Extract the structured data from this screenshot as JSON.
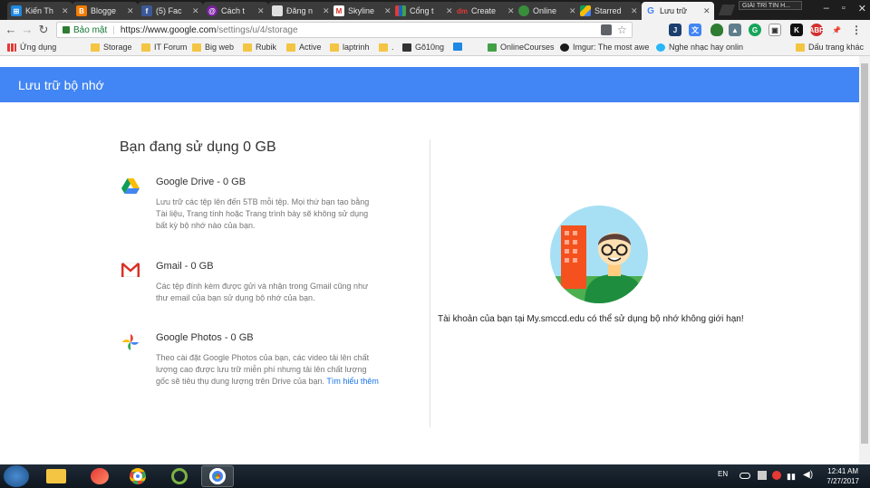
{
  "browser": {
    "tabs": [
      {
        "title": "Kiến Th",
        "icon": "windows-icon",
        "color": "#1e88e5"
      },
      {
        "title": "Blogge",
        "icon": "blogger-icon",
        "color": "#f57c00"
      },
      {
        "title": "(5) Fac",
        "icon": "facebook-icon",
        "color": "#3b5998"
      },
      {
        "title": "Cách t",
        "icon": "circle-icon",
        "color": "#7b1fa2"
      },
      {
        "title": "Đăng n",
        "icon": "page-icon",
        "color": "#9e9e9e"
      },
      {
        "title": "Skyline",
        "icon": "gmail-icon",
        "color": "#d93025"
      },
      {
        "title": "Cổng t",
        "icon": "bars-icon",
        "color": "#1565c0"
      },
      {
        "title": "Create",
        "icon": "dm-icon",
        "color": "#e53935"
      },
      {
        "title": "Online",
        "icon": "green-circle-icon",
        "color": "#388e3c"
      },
      {
        "title": "Starred",
        "icon": "drive-icon",
        "color": "#0f9d58"
      },
      {
        "title": "Lưu trữ",
        "icon": "google-icon",
        "color": "#4285f4",
        "active": true
      }
    ],
    "profile_label": "GIẢI TRÍ TIN H...",
    "address": {
      "secure_label": "Bảo mật",
      "host": "https://www.google.com",
      "path": "/settings/u/4/storage"
    },
    "bookmarks": [
      {
        "label": "Ứng dụng",
        "icon": "apps-icon",
        "color": "#e53935"
      },
      {
        "label": "Storage",
        "icon": "folder-icon",
        "color": "#f4c542"
      },
      {
        "label": "IT Forum",
        "icon": "folder-icon",
        "color": "#f4c542"
      },
      {
        "label": "Big web",
        "icon": "folder-icon",
        "color": "#f4c542"
      },
      {
        "label": "Rubik",
        "icon": "folder-icon",
        "color": "#f4c542"
      },
      {
        "label": "Active",
        "icon": "folder-icon",
        "color": "#f4c542"
      },
      {
        "label": "laptrinh",
        "icon": "folder-icon",
        "color": "#f4c542"
      },
      {
        "label": ".",
        "icon": "folder-icon",
        "color": "#f4c542"
      },
      {
        "label": "Gõ10ng",
        "icon": "keyboard-icon",
        "color": "#333333"
      },
      {
        "label": "",
        "icon": "link-icon",
        "color": "#1e88e5"
      },
      {
        "label": "OnlineCourses",
        "icon": "u-icon",
        "color": "#43a047"
      },
      {
        "label": "Imgur: The most awe",
        "icon": "imgur-icon",
        "color": "#1b1b1b"
      },
      {
        "label": "Nghe nhạc hay onlin",
        "icon": "music-icon",
        "color": "#29b6f6"
      },
      {
        "label": "Dấu trang khác",
        "icon": "folder-icon",
        "color": "#f4c542"
      }
    ]
  },
  "page": {
    "header_title": "Lưu trữ bộ nhớ",
    "usage_title": "Bạn đang sử dụng 0 GB",
    "services": [
      {
        "name": "Google Drive - 0 GB",
        "icon": "drive-icon",
        "desc": "Lưu trữ các tệp lên đến 5TB mỗi tệp. Mọi thứ bạn tạo bằng Tài liệu, Trang tính hoặc Trang trình bày sẽ không sử dụng bất kỳ bộ nhớ nào của bạn."
      },
      {
        "name": "Gmail - 0 GB",
        "icon": "gmail-icon",
        "desc": "Các tệp đính kèm được gửi và nhận trong Gmail cũng như thư email của bạn sử dụng bộ nhớ của bạn."
      },
      {
        "name": "Google Photos - 0 GB",
        "icon": "photos-icon",
        "desc": "Theo cài đặt Google Photos của bạn, các video tải lên chất lượng cao được lưu trữ miễn phí nhưng tải lên chất lượng gốc sẽ tiêu thụ dung lượng trên Drive của bạn.",
        "link": "Tìm hiểu thêm"
      }
    ],
    "unlimited_message": "Tài khoản của bạn tại My.smccd.edu có thể sử dụng bộ nhớ không giới hạn!"
  },
  "taskbar": {
    "lang": "EN",
    "time": "12:41 AM",
    "date": "7/27/2017"
  }
}
